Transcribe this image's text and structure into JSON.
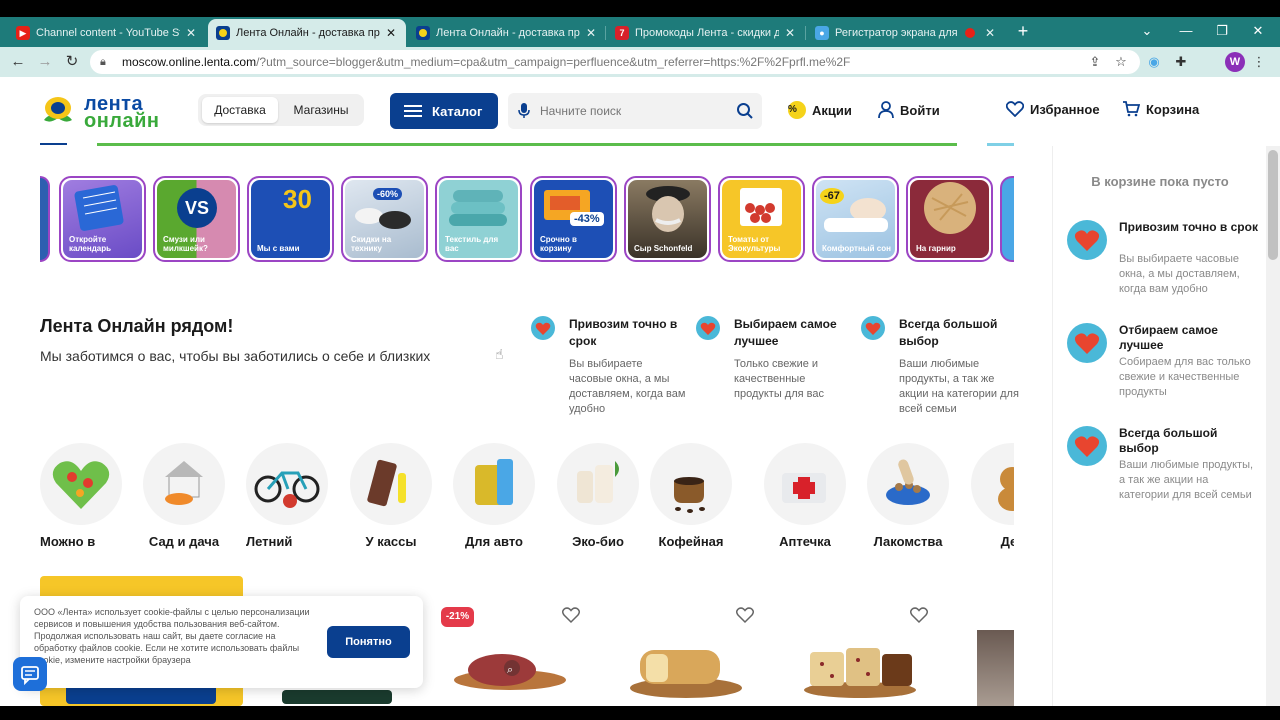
{
  "browser": {
    "tabs": [
      {
        "title": "Channel content - YouTube Studio",
        "favicon": "youtube-icon",
        "color": "#e62117"
      },
      {
        "title": "Лента Онлайн - доставка продуктов",
        "favicon": "lenta-icon",
        "color": "#0a3f8f"
      },
      {
        "title": "Лента Онлайн - доставка продуктов",
        "favicon": "lenta-icon",
        "color": "#0a3f8f"
      },
      {
        "title": "Промокоды Лента - скидки до",
        "favicon": "promo-icon",
        "color": "#d8212a"
      },
      {
        "title": "Регистратор экрана для Google",
        "favicon": "recorder-icon",
        "color": "#4aa7e6"
      }
    ],
    "url_host": "moscow.online.lenta.com",
    "url_path": "/?utm_source=blogger&utm_medium=cpa&utm_campaign=perfluence&utm_referrer=https:%2F%2Fprfl.me%2F",
    "profile_initial": "W"
  },
  "header": {
    "logo_top": "лента",
    "logo_bottom": "онлайн",
    "tab_delivery": "Доставка",
    "tab_stores": "Магазины",
    "catalog": "Каталог",
    "search_placeholder": "Начните поиск",
    "promos": "Акции",
    "login": "Войти",
    "favorites": "Избранное",
    "cart": "Корзина"
  },
  "stories": [
    {
      "caption": "Откройте календарь"
    },
    {
      "caption": "Смузи или милкшейк?"
    },
    {
      "caption": "Мы с вами"
    },
    {
      "caption": "Скидки на технику"
    },
    {
      "caption": "Текстиль для вас"
    },
    {
      "caption": "Срочно в корзину"
    },
    {
      "caption": "Сыр Schonfeld"
    },
    {
      "caption": "Томаты от Экокультуры"
    },
    {
      "caption": "Комфортный сон"
    },
    {
      "caption": "На гарнир"
    }
  ],
  "story_badges": {
    "vs": "VS",
    "thirty": "30",
    "sale60": "-60%",
    "sale43": "-43%",
    "sale67": "-67"
  },
  "about": {
    "title": "Лента Онлайн рядом!",
    "subtitle": "Мы заботимся о вас, чтобы вы заботились о себе и близких",
    "features": [
      {
        "title": "Привозим точно в срок",
        "desc": "Вы выбираете часовые окна, а мы доставляем, когда вам удобно"
      },
      {
        "title": "Выбираем самое лучшее",
        "desc": "Только свежие и качественные продукты для вас"
      },
      {
        "title": "Всегда большой выбор",
        "desc": "Ваши любимые продукты, а так же акции на категории для всей семьи"
      }
    ]
  },
  "categories": [
    {
      "label": "Можно в"
    },
    {
      "label": "Сад и дача"
    },
    {
      "label": "Летний"
    },
    {
      "label": "У кассы"
    },
    {
      "label": "Для авто"
    },
    {
      "label": "Эко-био"
    },
    {
      "label": "Кофейная"
    },
    {
      "label": "Аптечка"
    },
    {
      "label": "Лакомства"
    },
    {
      "label": "Дет"
    }
  ],
  "products": {
    "discount_badge": "-21%"
  },
  "cookie": {
    "text": "ООО «Лента» использует cookie-файлы с целью персонализации сервисов и повышения удобства пользования веб-сайтом. Продолжая использовать наш сайт, вы даете согласие на обработку файлов cookie. Если не хотите использовать файлы cookie, измените настройки браузера",
    "button": "Понятно"
  },
  "cart_panel": {
    "empty": "В корзине пока пусто",
    "items": [
      {
        "title": "Привозим точно в срок",
        "desc": "Вы выбираете часовые окна, а мы доставляем, когда вам удобно"
      },
      {
        "title": "Отбираем самое лучшее",
        "desc": "Собираем для вас только свежие и качественные продукты"
      },
      {
        "title": "Всегда большой выбор",
        "desc": "Ваши любимые продукты, а так же акции на категории для всей семьи"
      }
    ]
  },
  "colors": {
    "brand_blue": "#0a3f8f",
    "brand_green": "#39a93b",
    "accent_yellow": "#f5d31a",
    "sale_red": "#e43a4a",
    "story_border": "#9b45c4"
  }
}
